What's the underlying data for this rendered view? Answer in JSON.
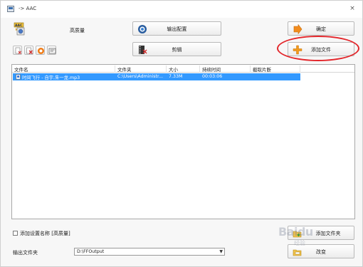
{
  "window": {
    "title": "-> AAC",
    "close_glyph": "×"
  },
  "quality": {
    "label": "高质量",
    "icon": "aac-format-icon"
  },
  "buttons": {
    "output_config": {
      "label": "输出配置",
      "icon": "output-config-icon"
    },
    "ok": {
      "label": "确定",
      "icon": "arrow-right-icon"
    },
    "edit": {
      "label": "剪辑",
      "icon": "film-edit-icon"
    },
    "add_file": {
      "label": "添加文件",
      "icon": "plus-icon"
    },
    "add_folder": {
      "label": "添加文件夹",
      "icon": "folder-add-icon"
    },
    "change": {
      "label": "改变",
      "icon": "folder-change-icon"
    }
  },
  "toolbar": {
    "tools": [
      "remove-file-icon",
      "clear-list-icon",
      "play-icon",
      "media-info-icon"
    ]
  },
  "list": {
    "columns": [
      "文件名",
      "文件夹",
      "大小",
      "持续时间",
      "截取片断"
    ],
    "rows": [
      {
        "filename": "时间飞行 - 自宇,朱一龙.mp3",
        "folder": "C:\\Users\\Administr...",
        "size": "7.33M",
        "duration": "00:03:06",
        "clip": "",
        "selected": true
      }
    ]
  },
  "options": {
    "add_setting_name_label": "添加设置名称 [高质量]",
    "add_setting_name_checked": false
  },
  "output": {
    "label": "输出文件夹",
    "folder_value": "D:\\FFOutput",
    "dropdown_arrow": "▼"
  },
  "watermark": {
    "brand": "Baidu",
    "sub": "经验"
  },
  "colors": {
    "selection": "#3399ff",
    "highlight_ring": "#e3262b"
  }
}
